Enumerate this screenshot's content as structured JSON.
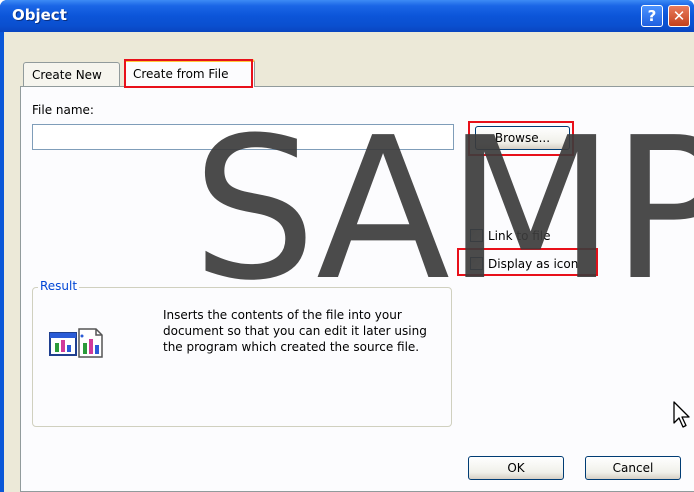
{
  "window": {
    "title": "Object",
    "help_label": "?",
    "close_label": "✕"
  },
  "tabs": [
    {
      "label": "Create New",
      "selected": false
    },
    {
      "label": "Create from File",
      "selected": true
    }
  ],
  "file": {
    "label": "File name:",
    "value": "",
    "browse_label": "Browse..."
  },
  "options": {
    "link_to_file": {
      "label": "Link to file",
      "checked": false
    },
    "display_as_icon": {
      "label": "Display as icon",
      "checked": false
    }
  },
  "result": {
    "title": "Result",
    "text": "Inserts the contents of the file into your document so that you can edit it later using the program which created the source file.",
    "icon": "insert-object-icon"
  },
  "buttons": {
    "ok_label": "OK",
    "cancel_label": "Cancel"
  },
  "watermark": "SAMP",
  "colors": {
    "titlebar": "#0a57d8",
    "highlight": "#e8101a",
    "group_title": "#0046d5",
    "dialog_bg": "#ece9d8"
  }
}
